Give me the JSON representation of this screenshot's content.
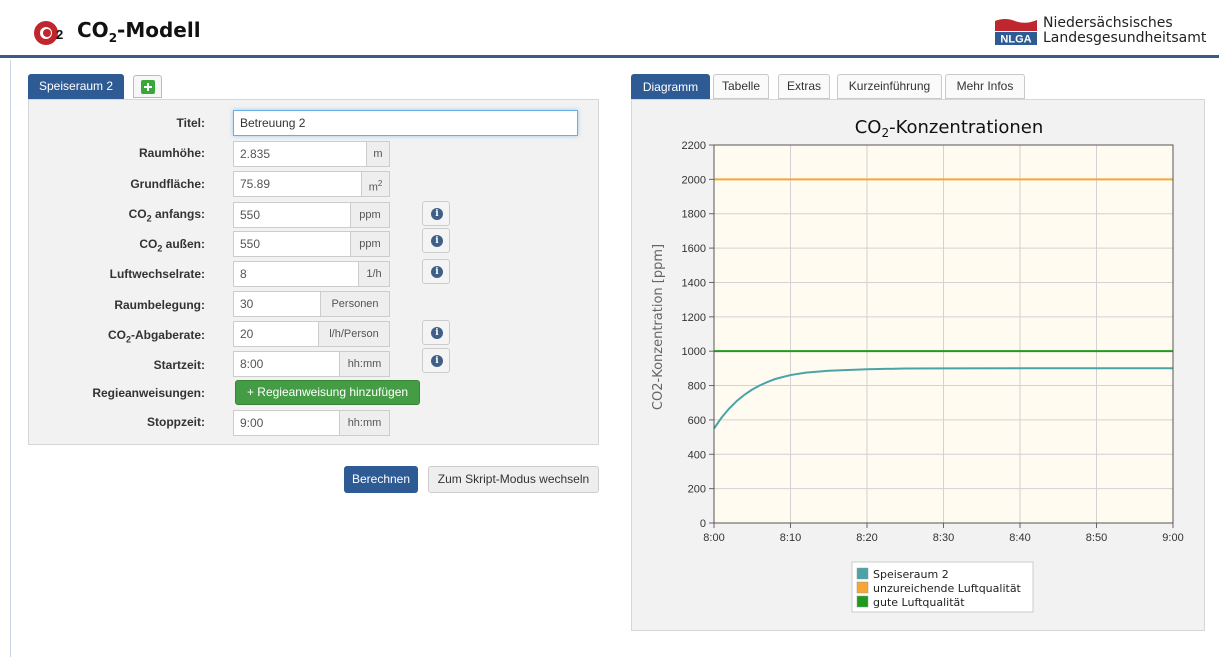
{
  "header": {
    "app_title_main": "CO",
    "app_title_sub": "2",
    "app_title_rest": "-Modell",
    "logo_char": "C",
    "logo_sub": "2",
    "nlga_short": "NLGA",
    "nlga_line1": "Niedersächsisches",
    "nlga_line2": "Landesgesundheitsamt"
  },
  "room_tabs": {
    "active": "Speiseraum 2",
    "add_icon": "plus-icon"
  },
  "form": {
    "titel_label": "Titel:",
    "titel_value": "Betreuung 2",
    "raumhoehe_label": "Raumhöhe:",
    "raumhoehe_value": "2.835",
    "raumhoehe_unit": "m",
    "grundflaeche_label": "Grundfläche:",
    "grundflaeche_value": "75.89",
    "grundflaeche_unit": "m",
    "grundflaeche_unit_sup": "2",
    "co2_anfangs_label_a": "CO",
    "co2_anfangs_label_sub": "2",
    "co2_anfangs_label_b": " anfangs:",
    "co2_anfangs_value": "550",
    "co2_anfangs_unit": "ppm",
    "co2_aussen_label_a": "CO",
    "co2_aussen_label_sub": "2",
    "co2_aussen_label_b": " außen:",
    "co2_aussen_value": "550",
    "co2_aussen_unit": "ppm",
    "luftwechsel_label": "Luftwechselrate:",
    "luftwechsel_value": "8",
    "luftwechsel_unit": "1/h",
    "raumbelegung_label": "Raumbelegung:",
    "raumbelegung_value": "30",
    "raumbelegung_unit": "Personen",
    "abgaberate_label_a": "CO",
    "abgaberate_label_sub": "2",
    "abgaberate_label_b": "-Abgaberate:",
    "abgaberate_value": "20",
    "abgaberate_unit": "l/h/Person",
    "startzeit_label": "Startzeit:",
    "startzeit_value": "8:00",
    "startzeit_unit": "hh:mm",
    "regie_label": "Regieanweisungen:",
    "regie_button": "+ Regieanweisung hinzufügen",
    "stoppzeit_label": "Stoppzeit:",
    "stoppzeit_value": "9:00",
    "stoppzeit_unit": "hh:mm",
    "info_icon": "i"
  },
  "actions": {
    "berechnen": "Berechnen",
    "skript": "Zum Skript-Modus wechseln"
  },
  "right_tabs": [
    "Diagramm",
    "Tabelle",
    "Extras",
    "Kurzeinführung",
    "Mehr Infos"
  ],
  "chart_data": {
    "type": "line",
    "title_a": "CO",
    "title_sub": "2",
    "title_b": "-Konzentrationen",
    "ylabel": "CO2-Konzentration [ppm]",
    "xlabel": "",
    "ylim": [
      0,
      2200
    ],
    "yticks": [
      0,
      200,
      400,
      600,
      800,
      1000,
      1200,
      1400,
      1600,
      1800,
      2000,
      2200
    ],
    "x_categories": [
      "8:00",
      "8:10",
      "8:20",
      "8:30",
      "8:40",
      "8:50",
      "9:00"
    ],
    "xlim_minutes": [
      0,
      60
    ],
    "grid": true,
    "legend_position": "bottom-center",
    "series": [
      {
        "name": "Speiseraum 2",
        "color": "#4aa3a6",
        "x_minutes": [
          0,
          1,
          2,
          3,
          4,
          5,
          6,
          7,
          8,
          10,
          12,
          15,
          20,
          25,
          30,
          40,
          50,
          60
        ],
        "values": [
          550,
          614,
          667,
          711,
          747,
          777,
          801,
          821,
          838,
          861,
          875,
          886,
          895,
          899,
          900,
          901,
          901,
          901
        ]
      },
      {
        "name": "unzureichende Luftqualität",
        "color": "#f5a637",
        "x_minutes": [
          0,
          60
        ],
        "values": [
          2000,
          2000
        ]
      },
      {
        "name": "gute Luftqualität",
        "color": "#1e9b1e",
        "x_minutes": [
          0,
          60
        ],
        "values": [
          1000,
          1000
        ]
      }
    ]
  },
  "colors": {
    "primary": "#2f5b95",
    "success": "#449d44",
    "plot_bg": "#fffbf0"
  }
}
